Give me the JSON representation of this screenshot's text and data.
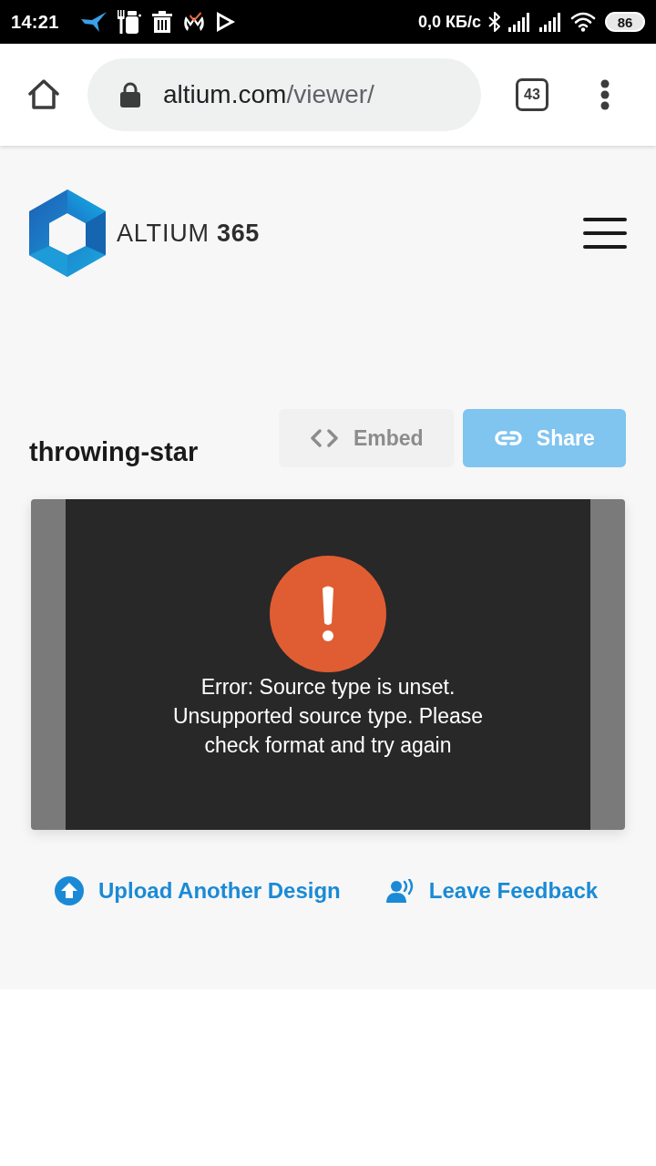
{
  "status_bar": {
    "time": "14:21",
    "network_speed": "0,0 КБ/с",
    "battery": "86"
  },
  "browser": {
    "url_host": "altium.com",
    "url_path": "/viewer/",
    "tab_count": "43"
  },
  "header": {
    "logo_text": "ALTIUM **365**"
  },
  "design": {
    "title": "throwing-star",
    "buttons": [
      {
        "kind": "embed",
        "label": "Embed",
        "disabled": true
      },
      {
        "kind": "share",
        "label": "Share",
        "disabled": true
      }
    ]
  },
  "viewer": {
    "message_lines": [
      "Error: Source type is unset.",
      "Unsupported source type. Please",
      "check format and try again"
    ]
  },
  "links": [
    {
      "kind": "upload",
      "label": "Upload Another Design"
    },
    {
      "kind": "feedback",
      "label": "Leave Feedback"
    }
  ]
}
